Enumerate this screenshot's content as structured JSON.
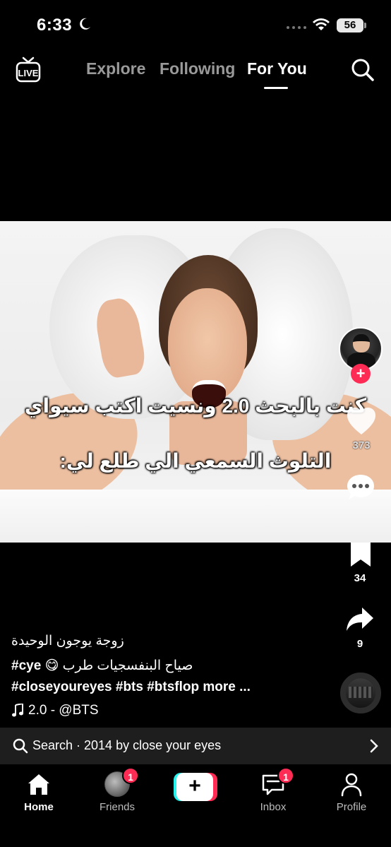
{
  "status_bar": {
    "time": "6:33",
    "battery": "56"
  },
  "top_nav": {
    "live_label": "LIVE",
    "tabs": [
      {
        "label": "Explore",
        "active": false
      },
      {
        "label": "Following",
        "active": false
      },
      {
        "label": "For You",
        "active": true
      }
    ]
  },
  "video": {
    "overlay_line_1": "كنت بالبحث 2.0 ونسيت اكتب سيواي",
    "overlay_line_2": "التلوث السمعي الي طلع لي:"
  },
  "actions": {
    "likes": "373",
    "bookmarks": "34",
    "shares": "9"
  },
  "description": {
    "title": "زوجة يوجون الوحيدة",
    "tags_line_1_en": "#cye",
    "tags_line_1_emoji": "😋",
    "tags_line_1_ar": "صياح البنفسجيات طرب",
    "tags_line_2": "#closeyoureyes #bts #btsflop more ...",
    "music": "2.0 - @BTS"
  },
  "search_suggestion": {
    "text": "Search · 2014 by close your eyes"
  },
  "bottom_nav": {
    "items": [
      {
        "label": "Home",
        "badge": ""
      },
      {
        "label": "Friends",
        "badge": "1"
      },
      {
        "label": "Inbox",
        "badge": "1"
      },
      {
        "label": "Profile",
        "badge": ""
      }
    ],
    "create_symbol": "+"
  },
  "colors": {
    "accent": "#fe2c55",
    "cyan": "#25f4ee",
    "background": "#000000"
  }
}
